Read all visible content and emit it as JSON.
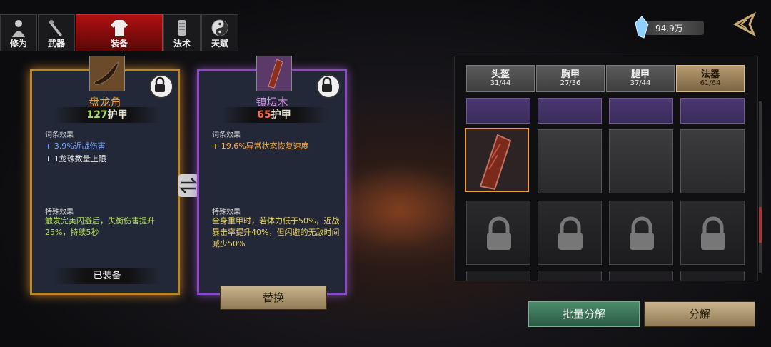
{
  "tabs": [
    {
      "label": "修为",
      "icon": "figure-icon"
    },
    {
      "label": "武器",
      "icon": "sword-icon"
    },
    {
      "label": "装备",
      "icon": "robe-icon"
    },
    {
      "label": "法术",
      "icon": "scroll-icon"
    },
    {
      "label": "天赋",
      "icon": "yin-yang-icon"
    }
  ],
  "currency": {
    "value": "94.9万",
    "icon": "crystal-icon"
  },
  "equipped_item": {
    "name": "盘龙角",
    "armor_value": "127",
    "armor_label": "护甲",
    "affix_title": "词条效果",
    "affixes": [
      "+ 3.9%近战伤害",
      "+ 1龙珠数量上限"
    ],
    "special_title": "特殊效果",
    "special_text": "触发完美闪避后，失衡伤害提升25%，持续5秒",
    "status": "已装备"
  },
  "compare_item": {
    "name": "镇坛木",
    "armor_value": "65",
    "armor_label": "护甲",
    "affix_title": "词条效果",
    "affixes": [
      "+ 19.6%异常状态恢复速度"
    ],
    "special_title": "特殊效果",
    "special_text": "全身重甲时，若体力低于50%，近战暴击率提升40%，但闪避的无敌时间减少50%",
    "action": "替换"
  },
  "inventory": {
    "categories": [
      {
        "label": "头盔",
        "count": "31/44"
      },
      {
        "label": "胸甲",
        "count": "27/36"
      },
      {
        "label": "腿甲",
        "count": "37/44"
      },
      {
        "label": "法器",
        "count": "61/64"
      }
    ]
  },
  "buttons": {
    "batch_dismantle": "批量分解",
    "dismantle": "分解"
  },
  "colors": {
    "active_tab": "#b01010",
    "gold_border": "#b8862c",
    "purple_border": "#8a4bbf"
  }
}
